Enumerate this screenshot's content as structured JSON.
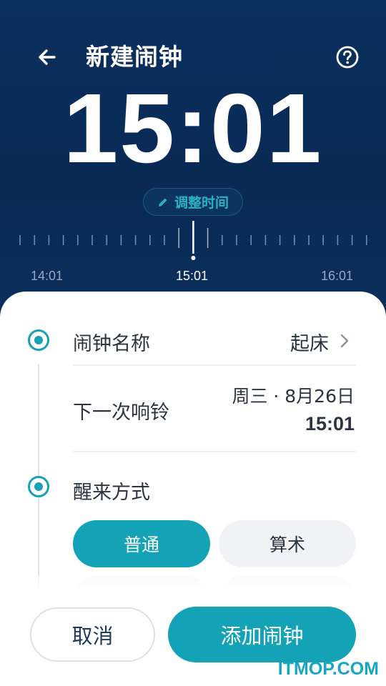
{
  "header": {
    "title": "新建闹钟",
    "time": "15:01",
    "adjust_label": "调整时间",
    "icons": {
      "back": "arrow-left-icon",
      "help": "question-circle-icon",
      "edit": "pencil-icon"
    }
  },
  "ruler": {
    "labels": {
      "left": "14:01",
      "center": "15:01",
      "right": "16:01"
    }
  },
  "settings": {
    "alarm_name": {
      "label": "闹钟名称",
      "value": "起床"
    },
    "next_ring": {
      "label": "下一次响铃",
      "date": "周三 · 8月26日",
      "time": "15:01"
    },
    "wake_method": {
      "label": "醒来方式",
      "options": [
        "普通",
        "算术"
      ],
      "selected": "普通"
    }
  },
  "actions": {
    "cancel": "取消",
    "add": "添加闹钟"
  },
  "watermark": "ITMOP.COM",
  "colors": {
    "accent": "#14a3b6",
    "header_bg": "#0b2f5e",
    "text": "#2c3442"
  }
}
